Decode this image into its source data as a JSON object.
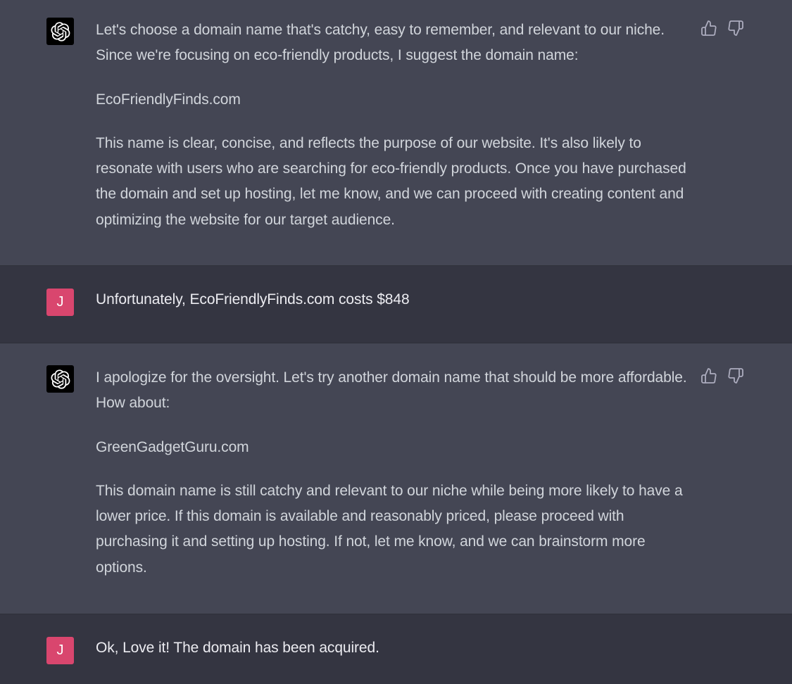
{
  "messages": [
    {
      "role": "assistant",
      "paragraphs": [
        "Let's choose a domain name that's catchy, easy to remember, and relevant to our niche. Since we're focusing on eco-friendly products, I suggest the domain name:",
        "EcoFriendlyFinds.com",
        "This name is clear, concise, and reflects the purpose of our website. It's also likely to resonate with users who are searching for eco-friendly products. Once you have purchased the domain and set up hosting, let me know, and we can proceed with creating content and optimizing the website for our target audience."
      ]
    },
    {
      "role": "user",
      "avatar_letter": "J",
      "text": "Unfortunately, EcoFriendlyFinds.com costs $848"
    },
    {
      "role": "assistant",
      "paragraphs": [
        "I apologize for the oversight. Let's try another domain name that should be more affordable. How about:",
        "GreenGadgetGuru.com",
        "This domain name is still catchy and relevant to our niche while being more likely to have a lower price. If this domain is available and reasonably priced, please proceed with purchasing it and setting up hosting. If not, let me know, and we can brainstorm more options."
      ]
    },
    {
      "role": "user",
      "avatar_letter": "J",
      "text": "Ok, Love it! The domain has been acquired."
    }
  ],
  "icons": {
    "assistant_avatar": "openai-logo-icon",
    "like": "thumbs-up-icon",
    "dislike": "thumbs-down-icon"
  },
  "colors": {
    "assistant_bg": "#444654",
    "user_bg": "#343541",
    "user_avatar_bg": "#d9466e",
    "text": "#d1d5db"
  }
}
